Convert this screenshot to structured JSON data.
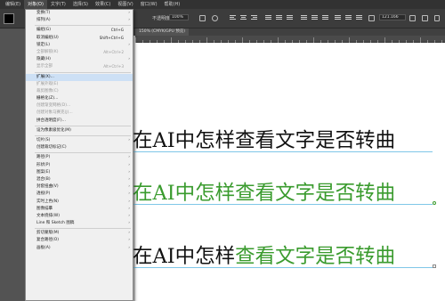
{
  "menubar": {
    "items": [
      "编辑(E)",
      "对象(O)",
      "文字(T)",
      "选择(S)",
      "效果(C)",
      "视图(V)",
      "窗口(W)",
      "帮助(H)"
    ],
    "active_index": 1
  },
  "control_bar": {
    "opacity_label": "不透明度:",
    "opacity_value": "100%",
    "x_value": "121.166",
    "document_tab": "150% (CMYK/GPU 预览)"
  },
  "dropdown": {
    "items": [
      {
        "label": "变换(T)",
        "shortcut": "",
        "submenu": true,
        "disabled": false
      },
      {
        "label": "排列(A)",
        "shortcut": "",
        "submenu": true,
        "disabled": false
      },
      {
        "sep": true
      },
      {
        "label": "编组(G)",
        "shortcut": "Ctrl+G",
        "submenu": false,
        "disabled": false
      },
      {
        "label": "取消编组(U)",
        "shortcut": "Shift+Ctrl+G",
        "submenu": false,
        "disabled": false
      },
      {
        "label": "锁定(L)",
        "shortcut": "",
        "submenu": true,
        "disabled": false
      },
      {
        "label": "全部解锁(K)",
        "shortcut": "Alt+Ctrl+2",
        "submenu": false,
        "disabled": true
      },
      {
        "label": "隐藏(H)",
        "shortcut": "",
        "submenu": true,
        "disabled": false
      },
      {
        "label": "显示全部",
        "shortcut": "Alt+Ctrl+3",
        "submenu": false,
        "disabled": true
      },
      {
        "sep": true
      },
      {
        "label": "扩展(X)...",
        "shortcut": "",
        "submenu": false,
        "disabled": false,
        "highlight": true
      },
      {
        "label": "扩展外观(E)",
        "shortcut": "",
        "submenu": false,
        "disabled": true
      },
      {
        "label": "裁剪图像(C)",
        "shortcut": "",
        "submenu": false,
        "disabled": true
      },
      {
        "label": "栅格化(Z)...",
        "shortcut": "",
        "submenu": false,
        "disabled": false
      },
      {
        "label": "创建渐变网格(D)...",
        "shortcut": "",
        "submenu": false,
        "disabled": true
      },
      {
        "label": "创建对象马赛克(J)...",
        "shortcut": "",
        "submenu": false,
        "disabled": true
      },
      {
        "label": "拼合透明度(F)...",
        "shortcut": "",
        "submenu": false,
        "disabled": false
      },
      {
        "sep": true
      },
      {
        "label": "设为像素级优化(M)",
        "shortcut": "",
        "submenu": false,
        "disabled": false
      },
      {
        "sep": true
      },
      {
        "label": "切片(S)",
        "shortcut": "",
        "submenu": true,
        "disabled": false
      },
      {
        "label": "创建裁切标记(C)",
        "shortcut": "",
        "submenu": false,
        "disabled": false
      },
      {
        "sep": true
      },
      {
        "label": "路径(P)",
        "shortcut": "",
        "submenu": true,
        "disabled": false
      },
      {
        "label": "形状(P)",
        "shortcut": "",
        "submenu": true,
        "disabled": false
      },
      {
        "label": "图案(E)",
        "shortcut": "",
        "submenu": true,
        "disabled": false
      },
      {
        "label": "混合(B)",
        "shortcut": "",
        "submenu": true,
        "disabled": false
      },
      {
        "label": "封套扭曲(V)",
        "shortcut": "",
        "submenu": true,
        "disabled": false
      },
      {
        "label": "透视(P)",
        "shortcut": "",
        "submenu": true,
        "disabled": false
      },
      {
        "label": "实时上色(N)",
        "shortcut": "",
        "submenu": true,
        "disabled": false
      },
      {
        "label": "图像描摹",
        "shortcut": "",
        "submenu": true,
        "disabled": false
      },
      {
        "label": "文本绕排(W)",
        "shortcut": "",
        "submenu": true,
        "disabled": false
      },
      {
        "label": "Line 和 Sketch 图稿",
        "shortcut": "",
        "submenu": true,
        "disabled": false
      },
      {
        "sep": true
      },
      {
        "label": "剪切蒙版(M)",
        "shortcut": "",
        "submenu": true,
        "disabled": false
      },
      {
        "label": "复合路径(O)",
        "shortcut": "",
        "submenu": true,
        "disabled": false
      },
      {
        "label": "画板(A)",
        "shortcut": "",
        "submenu": true,
        "disabled": false
      }
    ]
  },
  "canvas": {
    "line1": "在AI中怎样查看文字是否转曲",
    "line2": "在AI中怎样查看文字是否转曲",
    "line3_black": "在AI中怎样",
    "line3_green": "查看文字是否转曲",
    "green_color": "#3a9b2e"
  }
}
